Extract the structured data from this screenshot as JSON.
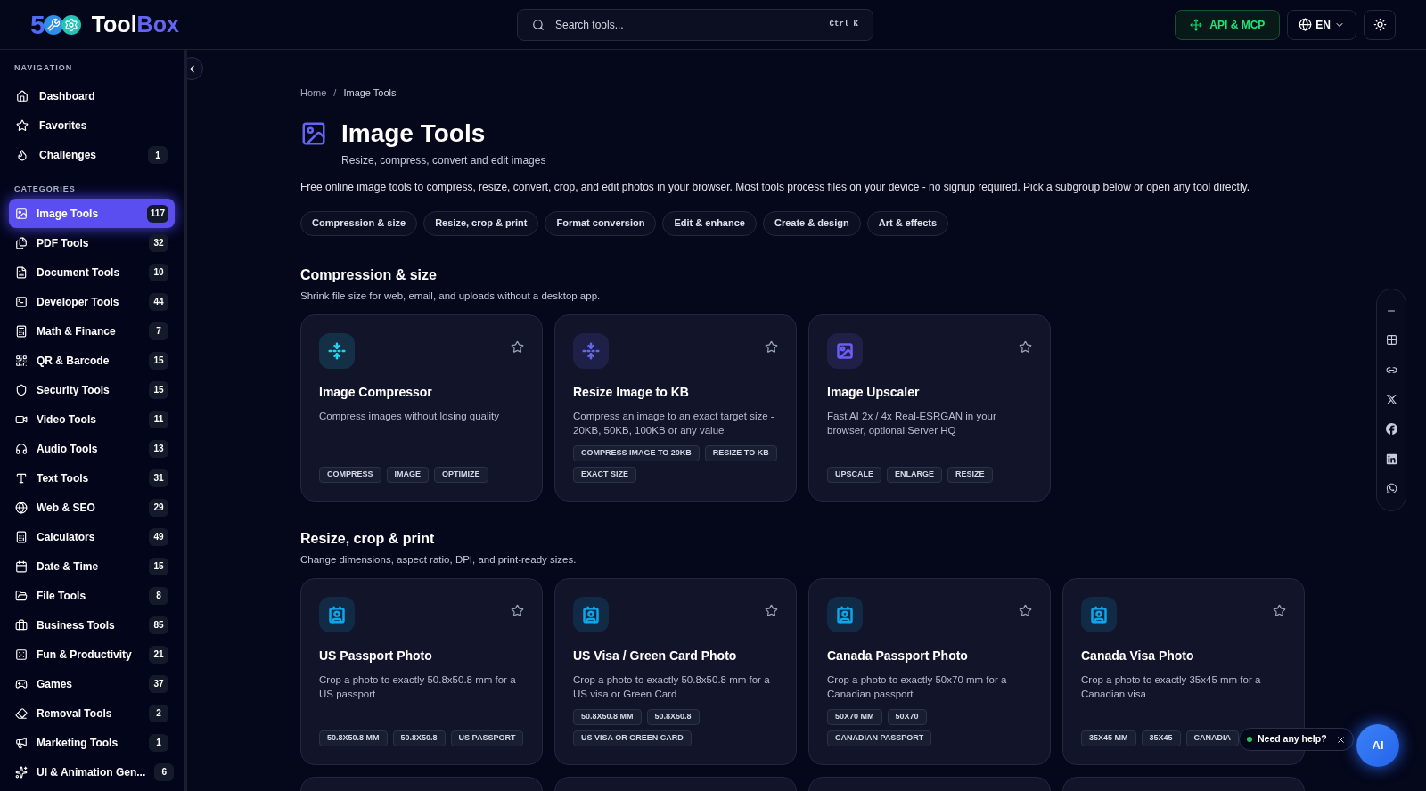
{
  "logo": {
    "digit": "5",
    "name_a": "Tool",
    "name_b": "Box"
  },
  "search": {
    "placeholder": "Search tools...",
    "shortcut": "Ctrl K"
  },
  "header_actions": {
    "api": "API & MCP",
    "language": "EN"
  },
  "sidebar": {
    "navigation_title": "NAVIGATION",
    "navigation": [
      {
        "label": "Dashboard"
      },
      {
        "label": "Favorites"
      },
      {
        "label": "Challenges",
        "count": "1"
      }
    ],
    "categories_title": "CATEGORIES",
    "categories": [
      {
        "label": "Image Tools",
        "count": "117",
        "selected": true
      },
      {
        "label": "PDF Tools",
        "count": "32",
        "selected": false
      },
      {
        "label": "Document Tools",
        "count": "10",
        "selected": false
      },
      {
        "label": "Developer Tools",
        "count": "44",
        "selected": false
      },
      {
        "label": "Math & Finance",
        "count": "7",
        "selected": false
      },
      {
        "label": "QR & Barcode",
        "count": "15",
        "selected": false
      },
      {
        "label": "Security Tools",
        "count": "15",
        "selected": false
      },
      {
        "label": "Video Tools",
        "count": "11",
        "selected": false
      },
      {
        "label": "Audio Tools",
        "count": "13",
        "selected": false
      },
      {
        "label": "Text Tools",
        "count": "31",
        "selected": false
      },
      {
        "label": "Web & SEO",
        "count": "29",
        "selected": false
      },
      {
        "label": "Calculators",
        "count": "49",
        "selected": false
      },
      {
        "label": "Date & Time",
        "count": "15",
        "selected": false
      },
      {
        "label": "File Tools",
        "count": "8",
        "selected": false
      },
      {
        "label": "Business Tools",
        "count": "85",
        "selected": false
      },
      {
        "label": "Fun & Productivity",
        "count": "21",
        "selected": false
      },
      {
        "label": "Games",
        "count": "37",
        "selected": false
      },
      {
        "label": "Removal Tools",
        "count": "2",
        "selected": false
      },
      {
        "label": "Marketing Tools",
        "count": "1",
        "selected": false
      },
      {
        "label": "UI & Animation Gen...",
        "count": "6",
        "selected": false
      }
    ]
  },
  "breadcrumb": {
    "separator": "/",
    "items": [
      "Home",
      "Image Tools"
    ]
  },
  "page": {
    "title": "Image Tools",
    "subtitle": "Resize, compress, convert and edit images",
    "description": "Free online image tools to compress, resize, convert, crop, and edit photos in your browser. Most tools process files on your device - no signup required. Pick a subgroup below or open any tool directly."
  },
  "subgroups": [
    "Compression & size",
    "Resize, crop & print",
    "Format conversion",
    "Edit & enhance",
    "Create & design",
    "Art & effects"
  ],
  "sections": [
    {
      "title": "Compression & size",
      "subtitle": "Shrink file size for web, email, and uploads without a desktop app.",
      "cards": [
        {
          "kind": "compress",
          "color": "#22d3ee",
          "title": "Image Compressor",
          "description": "Compress images without losing quality",
          "tags": [
            "COMPRESS",
            "IMAGE",
            "OPTIMIZE"
          ]
        },
        {
          "kind": "compress",
          "color": "#6366f1",
          "title": "Resize Image to KB",
          "description": "Compress an image to an exact target size - 20KB, 50KB, 100KB or any value",
          "tags": [
            "COMPRESS IMAGE TO 20KB",
            "RESIZE TO KB",
            "EXACT SIZE"
          ]
        },
        {
          "kind": "upscale",
          "color": "#6d5df6",
          "title": "Image Upscaler",
          "description": "Fast AI 2x / 4x Real-ESRGAN in your browser, optional Server HQ",
          "tags": [
            "UPSCALE",
            "ENLARGE",
            "RESIZE"
          ]
        }
      ]
    },
    {
      "title": "Resize, crop & print",
      "subtitle": "Change dimensions, aspect ratio, DPI, and print-ready sizes.",
      "cards": [
        {
          "kind": "id",
          "color": "#0ea5e9",
          "title": "US Passport Photo",
          "description": "Crop a photo to exactly 50.8x50.8 mm for a US passport",
          "tags": [
            "50.8X50.8 MM",
            "50.8X50.8",
            "US PASSPORT"
          ]
        },
        {
          "kind": "id",
          "color": "#0ea5e9",
          "title": "US Visa / Green Card Photo",
          "description": "Crop a photo to exactly 50.8x50.8 mm for a US visa or Green Card",
          "tags": [
            "50.8X50.8 MM",
            "50.8X50.8",
            "US VISA OR GREEN CARD"
          ]
        },
        {
          "kind": "id",
          "color": "#0ea5e9",
          "title": "Canada Passport Photo",
          "description": "Crop a photo to exactly 50x70 mm for a Canadian passport",
          "tags": [
            "50X70 MM",
            "50X70",
            "CANADIAN PASSPORT"
          ]
        },
        {
          "kind": "id",
          "color": "#0ea5e9",
          "title": "Canada Visa Photo",
          "description": "Crop a photo to exactly 35x45 mm for a Canadian visa",
          "tags": [
            "35X45 MM",
            "35X45",
            "CANADIA"
          ]
        }
      ]
    }
  ],
  "help_chip": {
    "label": "Need any help?"
  },
  "ai_button": {
    "label": "AI"
  }
}
